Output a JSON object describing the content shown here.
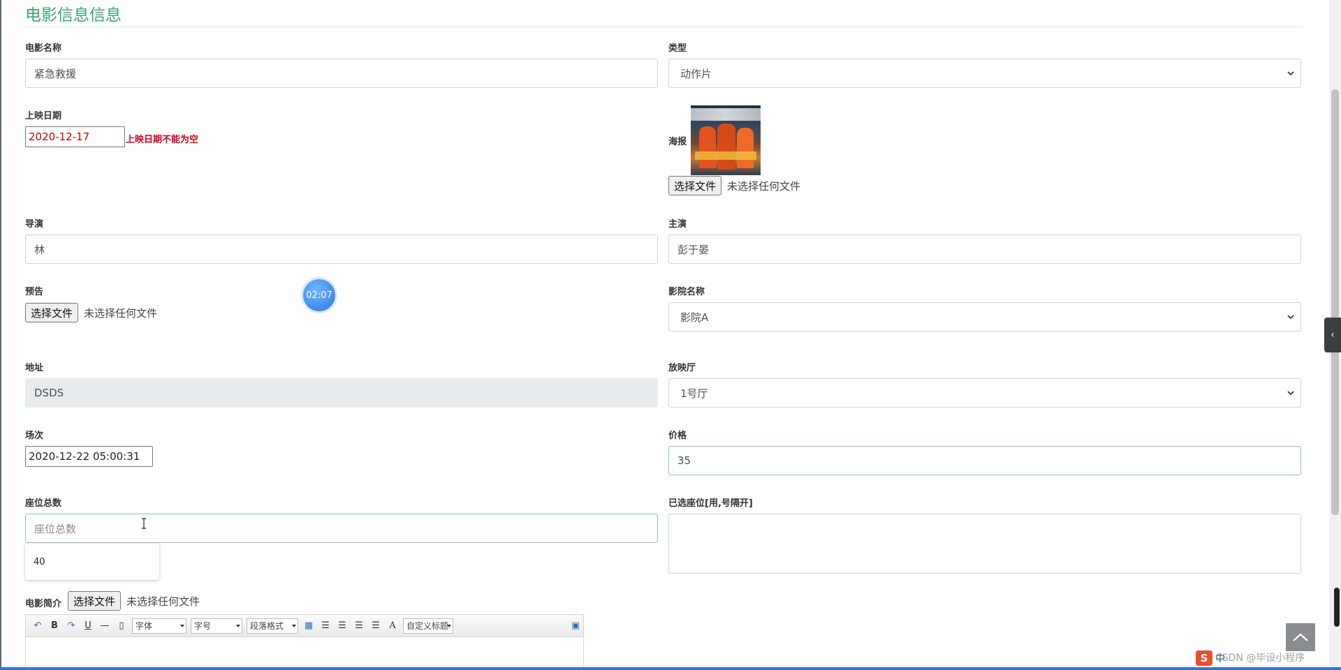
{
  "page": {
    "title": "电影信息信息"
  },
  "form": {
    "name": {
      "label": "电影名称",
      "value": "紧急救援"
    },
    "type": {
      "label": "类型",
      "value": "动作片"
    },
    "release_date": {
      "label": "上映日期",
      "value": "2020-12-17",
      "error": "上映日期不能为空"
    },
    "poster": {
      "label": "海报",
      "button": "选择文件",
      "note": "未选择任何文件"
    },
    "director": {
      "label": "导演",
      "value": "林"
    },
    "actor": {
      "label": "主演",
      "value": "彭于晏"
    },
    "trailer": {
      "label": "预告",
      "button": "选择文件",
      "note": "未选择任何文件"
    },
    "cinema": {
      "label": "影院名称",
      "value": "影院A"
    },
    "address": {
      "label": "地址",
      "value": "DSDS"
    },
    "hall": {
      "label": "放映厅",
      "value": "1号厅"
    },
    "showtime": {
      "label": "场次",
      "value": "2020-12-22 05:00:31"
    },
    "price": {
      "label": "价格",
      "value": "35"
    },
    "seats_total": {
      "label": "座位总数",
      "placeholder": "座位总数",
      "suggestion": "40"
    },
    "seats_selected": {
      "label": "已选座位[用,号隔开]",
      "value": ""
    },
    "intro": {
      "label": "电影简介",
      "button": "选择文件",
      "note": "未选择任何文件"
    }
  },
  "timer": {
    "text": "02:07"
  },
  "editor_toolbar": {
    "font_family": "字体",
    "font_size": "字号",
    "paragraph": "段落格式",
    "custom_title": "自定义标题",
    "icons": [
      "undo-icon",
      "bold-icon",
      "redo-icon",
      "underline-icon",
      "horizontal-rule-icon",
      "page-icon",
      "table-icon",
      "align-left-icon",
      "align-center-icon",
      "align-right-icon",
      "justify-icon",
      "font-color-icon",
      "preview-icon"
    ],
    "bold": "B",
    "underline": "U",
    "font_color": "A"
  },
  "ime": {
    "logo": "S",
    "lang": "中"
  },
  "watermark": {
    "text": "CSDN @毕设小程序"
  },
  "colors": {
    "title": "#3aa36e",
    "error": "#d0021b",
    "accent": "#2f78d2"
  }
}
